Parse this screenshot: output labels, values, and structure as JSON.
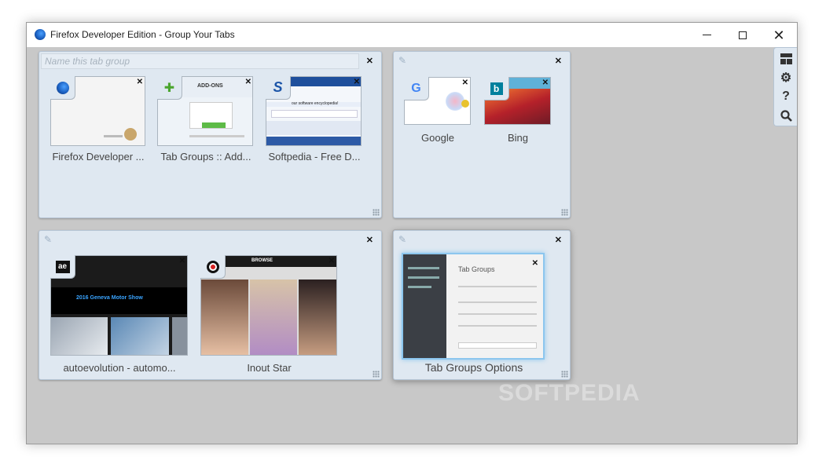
{
  "window": {
    "title": "Firefox Developer Edition - Group Your Tabs"
  },
  "groups": [
    {
      "name_placeholder": "Name this tab group",
      "tabs": [
        {
          "label": "Firefox Developer ...",
          "icon": "firefox-icon"
        },
        {
          "label": "Tab Groups :: Add...",
          "icon": "puzzle-icon",
          "thumb_text": "ADD-ONS"
        },
        {
          "label": "Softpedia - Free D...",
          "icon": "softpedia-icon",
          "thumb_text": "our software encyclopedia!"
        }
      ]
    },
    {
      "tabs": [
        {
          "label": "Google",
          "icon": "google-icon"
        },
        {
          "label": "Bing",
          "icon": "bing-icon"
        }
      ]
    },
    {
      "tabs": [
        {
          "label": "autoevolution - automo...",
          "icon": "autoevolution-icon",
          "thumb_text": "2016 Geneva Motor Show"
        },
        {
          "label": "Inout Star",
          "icon": "inoutstar-icon",
          "thumb_text": "BROWSE"
        }
      ]
    },
    {
      "tabs": [
        {
          "label": "Tab Groups Options",
          "icon": "tab-groups-icon",
          "thumb_title": "Tab Groups"
        }
      ]
    }
  ],
  "toolbar": {
    "items": [
      "groups-icon",
      "gear-icon",
      "help-icon",
      "search-icon"
    ],
    "help_glyph": "?"
  },
  "watermark": "SOFTPEDIA"
}
